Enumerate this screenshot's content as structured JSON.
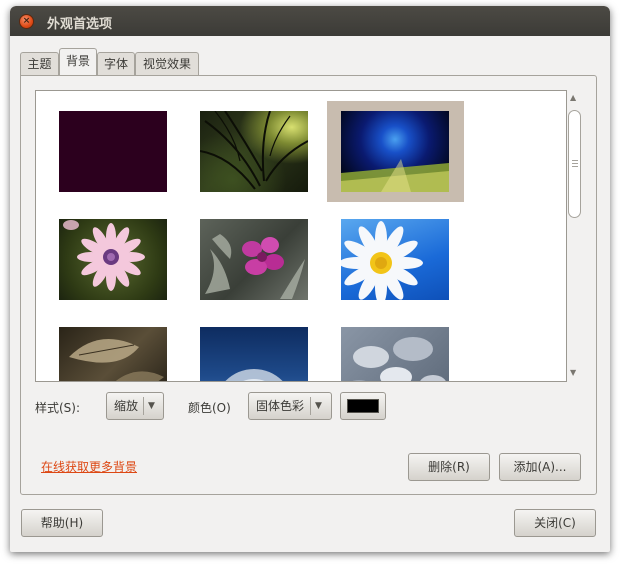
{
  "window": {
    "title": "外观首选项",
    "close_glyph": "×"
  },
  "tabs": [
    {
      "label": "主题",
      "active": false
    },
    {
      "label": "背景",
      "active": true
    },
    {
      "label": "字体",
      "active": false
    },
    {
      "label": "视觉效果",
      "active": false
    }
  ],
  "wallpapers": [
    {
      "description": "solid dark purple",
      "color": "#2c001e",
      "selected": false
    },
    {
      "description": "dark tree branches",
      "selected": false
    },
    {
      "description": "blue and green light rays",
      "selected": true
    },
    {
      "description": "pink daisy",
      "selected": false
    },
    {
      "description": "magenta flower with grey leaves",
      "selected": false
    },
    {
      "description": "white daisy on blue sky",
      "selected": false
    },
    {
      "description": "brown dry leaves",
      "selected": false
    },
    {
      "description": "dandelion on blue",
      "selected": false
    },
    {
      "description": "grey pebbles",
      "selected": false
    }
  ],
  "controls": {
    "style_label": "样式(S):",
    "style_value": "缩放",
    "color_label": "颜色(O)",
    "color_mode_value": "固体色彩",
    "color_value": "#000000",
    "more_link": "在线获取更多背景",
    "remove_button": "删除(R)",
    "add_button": "添加(A)...",
    "help_button": "帮助(H)",
    "close_button": "关闭(C)"
  },
  "scroll": {
    "up_glyph": "▲",
    "down_glyph": "▼"
  },
  "accent_color": "#dd4814"
}
